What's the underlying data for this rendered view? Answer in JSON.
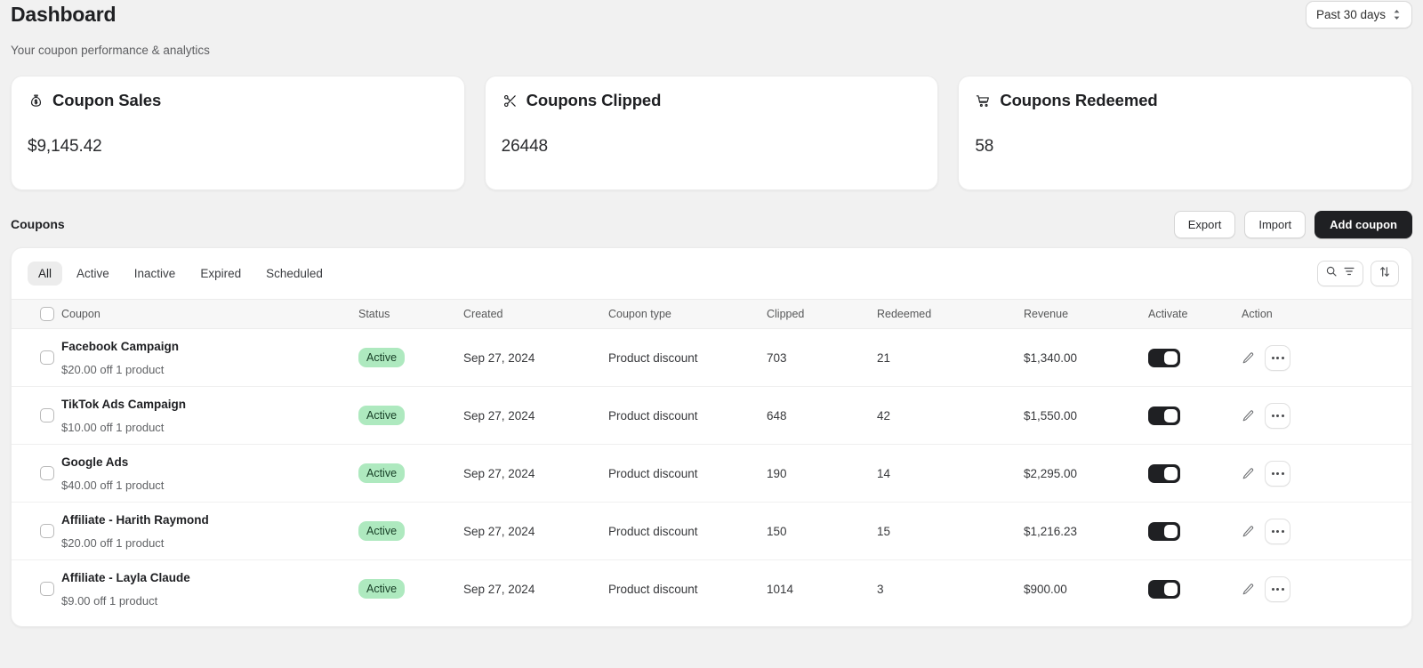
{
  "header": {
    "title": "Dashboard",
    "subtitle": "Your coupon performance & analytics",
    "date_range": "Past 30 days"
  },
  "metrics": [
    {
      "icon": "money-bag-icon",
      "title": "Coupon Sales",
      "value": "$9,145.42"
    },
    {
      "icon": "scissors-icon",
      "title": "Coupons Clipped",
      "value": "26448"
    },
    {
      "icon": "shopping-cart-icon",
      "title": "Coupons Redeemed",
      "value": "58"
    }
  ],
  "section": {
    "title": "Coupons",
    "export_label": "Export",
    "import_label": "Import",
    "add_label": "Add coupon"
  },
  "tabs": [
    {
      "label": "All",
      "active": true
    },
    {
      "label": "Active",
      "active": false
    },
    {
      "label": "Inactive",
      "active": false
    },
    {
      "label": "Expired",
      "active": false
    },
    {
      "label": "Scheduled",
      "active": false
    }
  ],
  "table": {
    "columns": [
      "Coupon",
      "Status",
      "Created",
      "Coupon type",
      "Clipped",
      "Redeemed",
      "Revenue",
      "Activate",
      "Action"
    ],
    "rows": [
      {
        "name": "Facebook Campaign",
        "detail": "$20.00 off 1 product",
        "status": "Active",
        "created": "Sep 27, 2024",
        "type": "Product discount",
        "clipped": "703",
        "redeemed": "21",
        "revenue": "$1,340.00",
        "activated": true
      },
      {
        "name": "TikTok Ads Campaign",
        "detail": "$10.00 off 1 product",
        "status": "Active",
        "created": "Sep 27, 2024",
        "type": "Product discount",
        "clipped": "648",
        "redeemed": "42",
        "revenue": "$1,550.00",
        "activated": true
      },
      {
        "name": "Google Ads",
        "detail": "$40.00 off 1 product",
        "status": "Active",
        "created": "Sep 27, 2024",
        "type": "Product discount",
        "clipped": "190",
        "redeemed": "14",
        "revenue": "$2,295.00",
        "activated": true
      },
      {
        "name": "Affiliate - Harith Raymond",
        "detail": "$20.00 off 1 product",
        "status": "Active",
        "created": "Sep 27, 2024",
        "type": "Product discount",
        "clipped": "150",
        "redeemed": "15",
        "revenue": "$1,216.23",
        "activated": true
      },
      {
        "name": "Affiliate - Layla Claude",
        "detail": "$9.00 off 1 product",
        "status": "Active",
        "created": "Sep 27, 2024",
        "type": "Product discount",
        "clipped": "1014",
        "redeemed": "3",
        "revenue": "$900.00",
        "activated": true
      }
    ]
  },
  "colors": {
    "page_background": "#f1f1f1",
    "card_background": "#ffffff",
    "primary_button": "#1f2023",
    "status_active_bg": "#aee9bf",
    "status_active_text": "#163d25"
  }
}
